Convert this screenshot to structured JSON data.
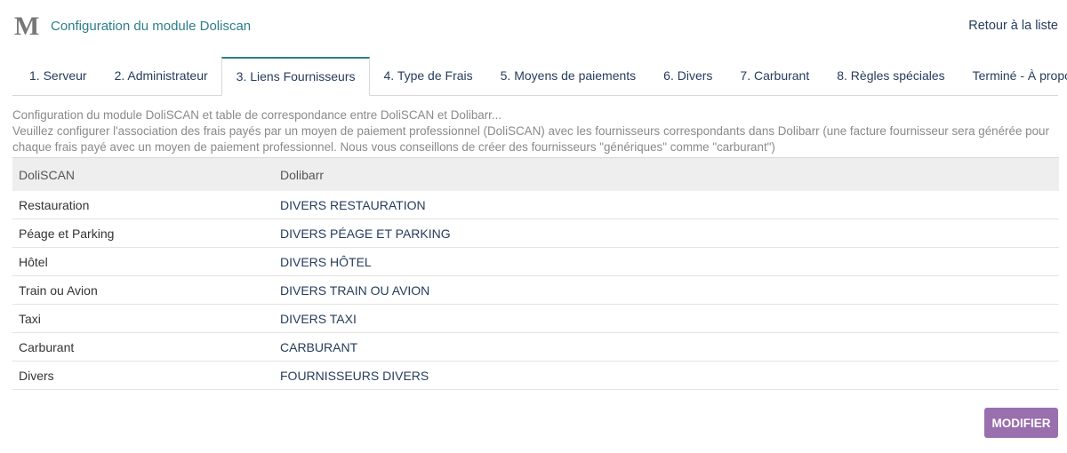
{
  "header": {
    "logo_letter": "M",
    "title": "Configuration du module Doliscan",
    "back_link": "Retour à la liste"
  },
  "tabs": [
    {
      "label": "1. Serveur",
      "active": false
    },
    {
      "label": "2. Administrateur",
      "active": false
    },
    {
      "label": "3. Liens Fournisseurs",
      "active": true
    },
    {
      "label": "4. Type de Frais",
      "active": false
    },
    {
      "label": "5. Moyens de paiements",
      "active": false
    },
    {
      "label": "6. Divers",
      "active": false
    },
    {
      "label": "7. Carburant",
      "active": false
    },
    {
      "label": "8. Règles spéciales",
      "active": false
    },
    {
      "label": "Terminé - À propos",
      "active": false
    }
  ],
  "description": {
    "line1": "Configuration du module DoliSCAN et table de correspondance entre DoliSCAN et Dolibarr...",
    "line2": "Veuillez configurer l'association des frais payés par un moyen de paiement professionnel (DoliSCAN) avec les fournisseurs correspondants dans Dolibarr (une facture fournisseur sera générée pour chaque frais payé avec un moyen de paiement professionnel. Nous vous conseillons de créer des fournisseurs \"génériques\" comme \"carburant\")"
  },
  "table": {
    "headers": [
      "DoliSCAN",
      "Dolibarr"
    ],
    "rows": [
      [
        "Restauration",
        "DIVERS RESTAURATION"
      ],
      [
        "Péage et Parking",
        "DIVERS PÉAGE ET PARKING"
      ],
      [
        "Hôtel",
        "DIVERS HÔTEL"
      ],
      [
        "Train ou Avion",
        "DIVERS TRAIN OU AVION"
      ],
      [
        "Taxi",
        "DIVERS TAXI"
      ],
      [
        "Carburant",
        "CARBURANT"
      ],
      [
        "Divers",
        "FOURNISSEURS DIVERS"
      ]
    ]
  },
  "buttons": {
    "modify": "MODIFIER"
  },
  "colors": {
    "accent": "#2b7f8a",
    "link": "#263c5c",
    "button": "#9a6fae"
  }
}
